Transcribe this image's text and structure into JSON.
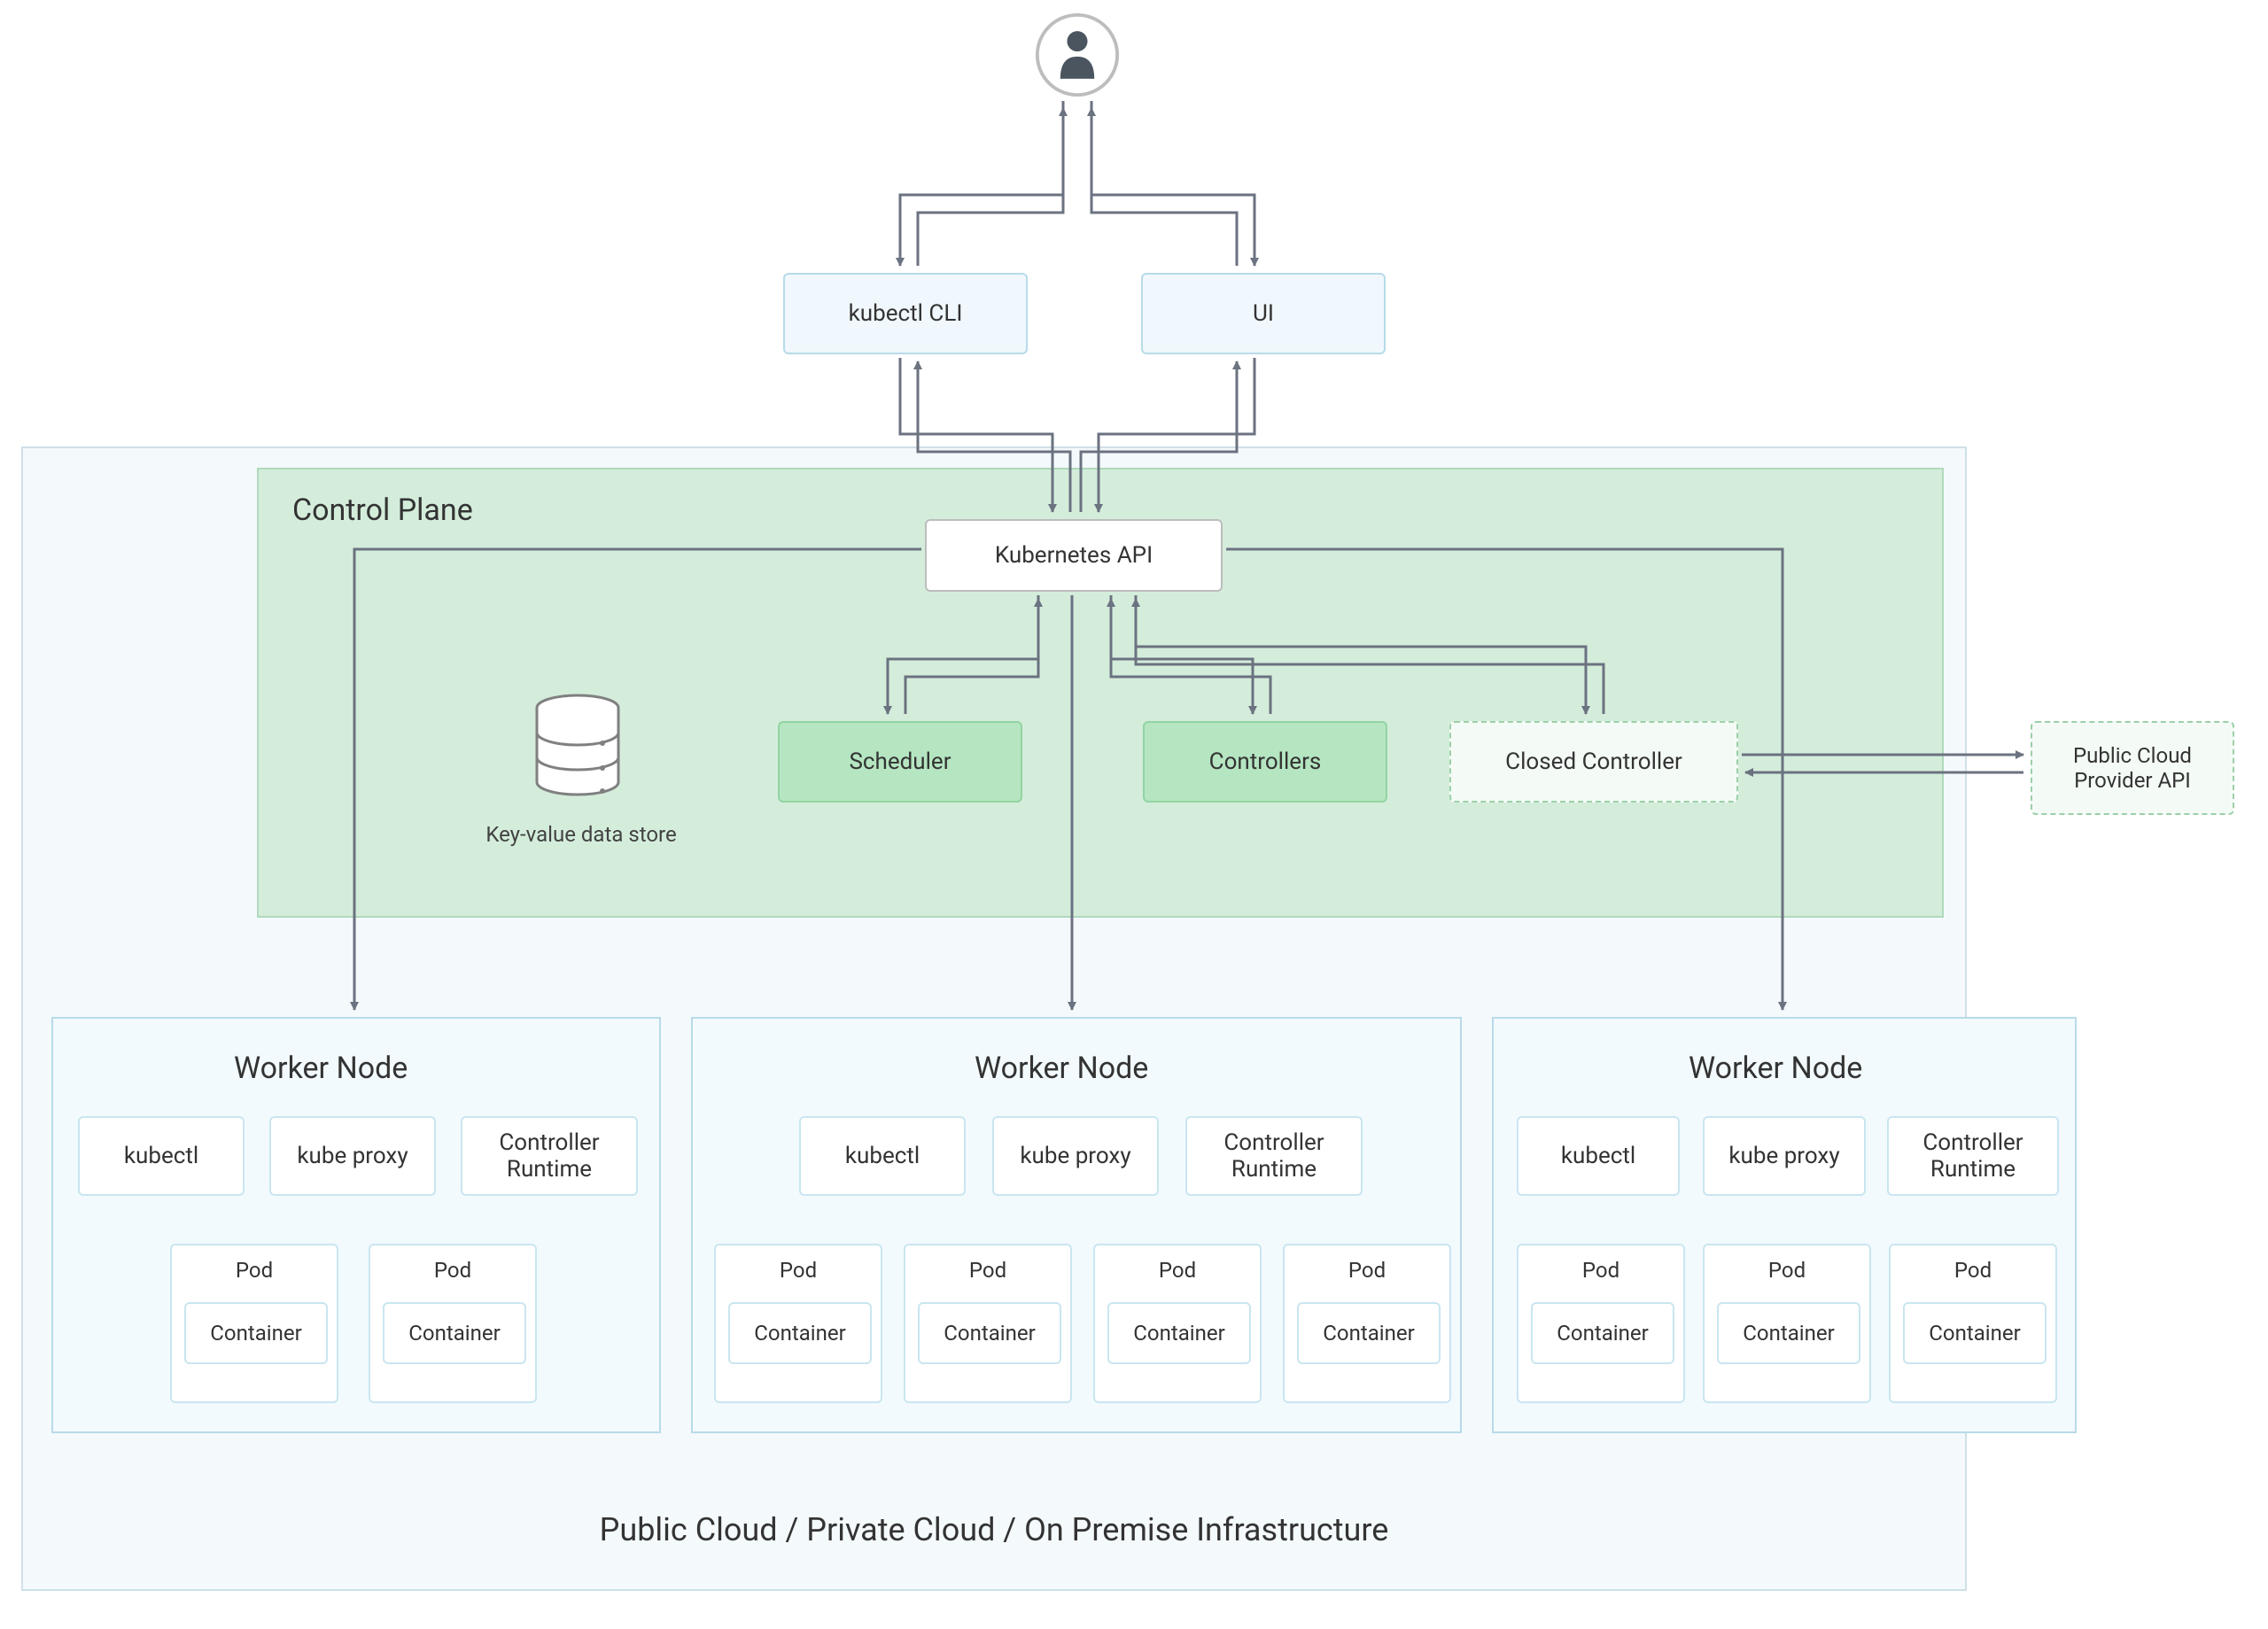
{
  "user": {
    "icon": "user-icon"
  },
  "clients": {
    "kubectl": "kubectl CLI",
    "ui": "UI"
  },
  "outer": {
    "footer": "Public Cloud / Private Cloud / On Premise Infrastructure"
  },
  "control_plane": {
    "title": "Control Plane",
    "api": "Kubernetes API",
    "scheduler": "Scheduler",
    "controllers": "Controllers",
    "closed_controller": "Closed Controller",
    "datastore": "Key-value data store"
  },
  "external": {
    "provider_api": "Public Cloud\nProvider API"
  },
  "workers": [
    {
      "title": "Worker Node",
      "services": [
        "kubectl",
        "kube proxy",
        "Controller Runtime"
      ],
      "pods": [
        {
          "label": "Pod",
          "container": "Container"
        },
        {
          "label": "Pod",
          "container": "Container"
        }
      ]
    },
    {
      "title": "Worker Node",
      "services": [
        "kubectl",
        "kube proxy",
        "Controller Runtime"
      ],
      "pods": [
        {
          "label": "Pod",
          "container": "Container"
        },
        {
          "label": "Pod",
          "container": "Container"
        },
        {
          "label": "Pod",
          "container": "Container"
        },
        {
          "label": "Pod",
          "container": "Container"
        }
      ]
    },
    {
      "title": "Worker Node",
      "services": [
        "kubectl",
        "kube proxy",
        "Controller Runtime"
      ],
      "pods": [
        {
          "label": "Pod",
          "container": "Container"
        },
        {
          "label": "Pod",
          "container": "Container"
        },
        {
          "label": "Pod",
          "container": "Container"
        }
      ]
    }
  ]
}
